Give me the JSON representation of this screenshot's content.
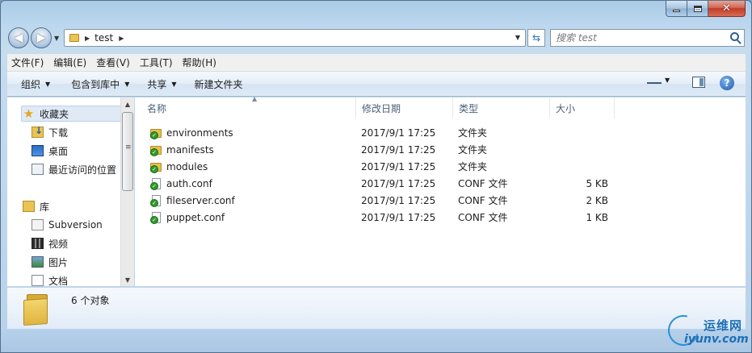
{
  "window": {
    "caption_close": "✕"
  },
  "navigation": {
    "back_glyph": "◀",
    "forward_glyph": "▶",
    "breadcrumb": [
      "test"
    ],
    "search_placeholder": "搜索 test"
  },
  "menubar": {
    "items": [
      "文件(F)",
      "编辑(E)",
      "查看(V)",
      "工具(T)",
      "帮助(H)"
    ]
  },
  "commandbar": {
    "organize": "组织",
    "include_library": "包含到库中",
    "share": "共享",
    "new_folder": "新建文件夹",
    "help_glyph": "?"
  },
  "sidebar": {
    "favorites": {
      "label": "收藏夹",
      "items": [
        "下载",
        "桌面",
        "最近访问的位置"
      ]
    },
    "libraries": {
      "label": "库",
      "items": [
        "Subversion",
        "视频",
        "图片",
        "文档"
      ]
    }
  },
  "filelist": {
    "columns": [
      "名称",
      "修改日期",
      "类型",
      "大小"
    ],
    "rows": [
      {
        "name": "environments",
        "modified": "2017/9/1 17:25",
        "type": "文件夹",
        "size": "",
        "kind": "folder"
      },
      {
        "name": "manifests",
        "modified": "2017/9/1 17:25",
        "type": "文件夹",
        "size": "",
        "kind": "folder"
      },
      {
        "name": "modules",
        "modified": "2017/9/1 17:25",
        "type": "文件夹",
        "size": "",
        "kind": "folder"
      },
      {
        "name": "auth.conf",
        "modified": "2017/9/1 17:25",
        "type": "CONF 文件",
        "size": "5 KB",
        "kind": "file"
      },
      {
        "name": "fileserver.conf",
        "modified": "2017/9/1 17:25",
        "type": "CONF 文件",
        "size": "2 KB",
        "kind": "file"
      },
      {
        "name": "puppet.conf",
        "modified": "2017/9/1 17:25",
        "type": "CONF 文件",
        "size": "1 KB",
        "kind": "file"
      }
    ]
  },
  "details": {
    "count_text": "6 个对象"
  },
  "watermark": {
    "cn": "运维网",
    "en": "iyunv.com"
  },
  "colors": {
    "svn_ok_badge": "#2f9b27",
    "folder": "#e6c04d"
  }
}
